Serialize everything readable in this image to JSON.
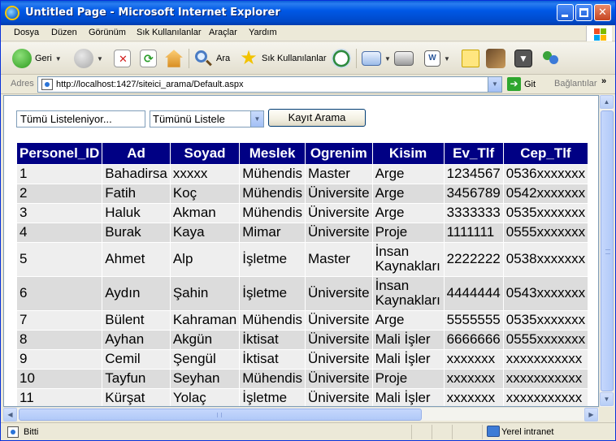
{
  "window": {
    "title": "Untitled Page - Microsoft Internet Explorer",
    "minimize": "",
    "maximize": "",
    "close": "✕"
  },
  "menu": {
    "items": [
      "Dosya",
      "Düzen",
      "Görünüm",
      "Sık Kullanılanlar",
      "Araçlar",
      "Yardım"
    ]
  },
  "toolbar": {
    "back_label": "Geri",
    "search_label": "Ara",
    "favorites_label": "Sık Kullanılanlar"
  },
  "address": {
    "label": "Adres",
    "url": "http://localhost:1427/siteici_arama/Default.aspx",
    "go_label": "Git",
    "links_label": "Bağlantılar",
    "links_chevron": "»"
  },
  "form": {
    "text_value": "Tümü Listeleniyor...",
    "select_value": "Tümünü Listele",
    "search_button": "Kayıt Arama"
  },
  "grid": {
    "headers": [
      "Personel_ID",
      "Ad",
      "Soyad",
      "Meslek",
      "Ogrenim",
      "Kisim",
      "Ev_Tlf",
      "Cep_Tlf"
    ],
    "rows": [
      [
        "1",
        "Bahadirsa",
        "xxxxx",
        "Mühendis",
        "Master",
        "Arge",
        "1234567",
        "0536xxxxxxx"
      ],
      [
        "2",
        "Fatih",
        "Koç",
        "Mühendis",
        "Üniversite",
        "Arge",
        "3456789",
        "0542xxxxxxx"
      ],
      [
        "3",
        "Haluk",
        "Akman",
        "Mühendis",
        "Üniversite",
        "Arge",
        "3333333",
        "0535xxxxxxx"
      ],
      [
        "4",
        "Burak",
        "Kaya",
        "Mimar",
        "Üniversite",
        "Proje",
        "1111111",
        "0555xxxxxxx"
      ],
      [
        "5",
        "Ahmet",
        "Alp",
        "İşletme",
        "Master",
        "İnsan Kaynakları",
        "2222222",
        "0538xxxxxxx"
      ],
      [
        "6",
        "Aydın",
        "Şahin",
        "İşletme",
        "Üniversite",
        "İnsan Kaynakları",
        "4444444",
        "0543xxxxxxx"
      ],
      [
        "7",
        "Bülent",
        "Kahraman",
        "Mühendis",
        "Üniversite",
        "Arge",
        "5555555",
        "0535xxxxxxx"
      ],
      [
        "8",
        "Ayhan",
        "Akgün",
        "İktisat",
        "Üniversite",
        "Mali İşler",
        "6666666",
        "0555xxxxxxx"
      ],
      [
        "9",
        "Cemil",
        "Şengül",
        "İktisat",
        "Üniversite",
        "Mali İşler",
        "xxxxxxx",
        "xxxxxxxxxxx"
      ],
      [
        "10",
        "Tayfun",
        "Seyhan",
        "Mühendis",
        "Üniversite",
        "Proje",
        "xxxxxxx",
        "xxxxxxxxxxx"
      ],
      [
        "11",
        "Kürşat",
        "Yolaç",
        "İşletme",
        "Üniversite",
        "Mali İşler",
        "xxxxxxx",
        "xxxxxxxxxxx"
      ]
    ]
  },
  "status": {
    "text": "Bitti",
    "zone": "Yerel intranet"
  },
  "colors": {
    "grid_header_bg": "#000084",
    "titlebar": "#0058e6"
  },
  "icons": [
    "ie-logo-icon",
    "back-icon",
    "forward-icon",
    "stop-icon",
    "refresh-icon",
    "home-icon",
    "search-icon",
    "favorites-icon",
    "history-icon",
    "mail-icon",
    "print-icon",
    "edit-icon",
    "folder-icon",
    "research-icon",
    "messenger-icon",
    "page-icon",
    "go-icon",
    "zone-icon"
  ]
}
